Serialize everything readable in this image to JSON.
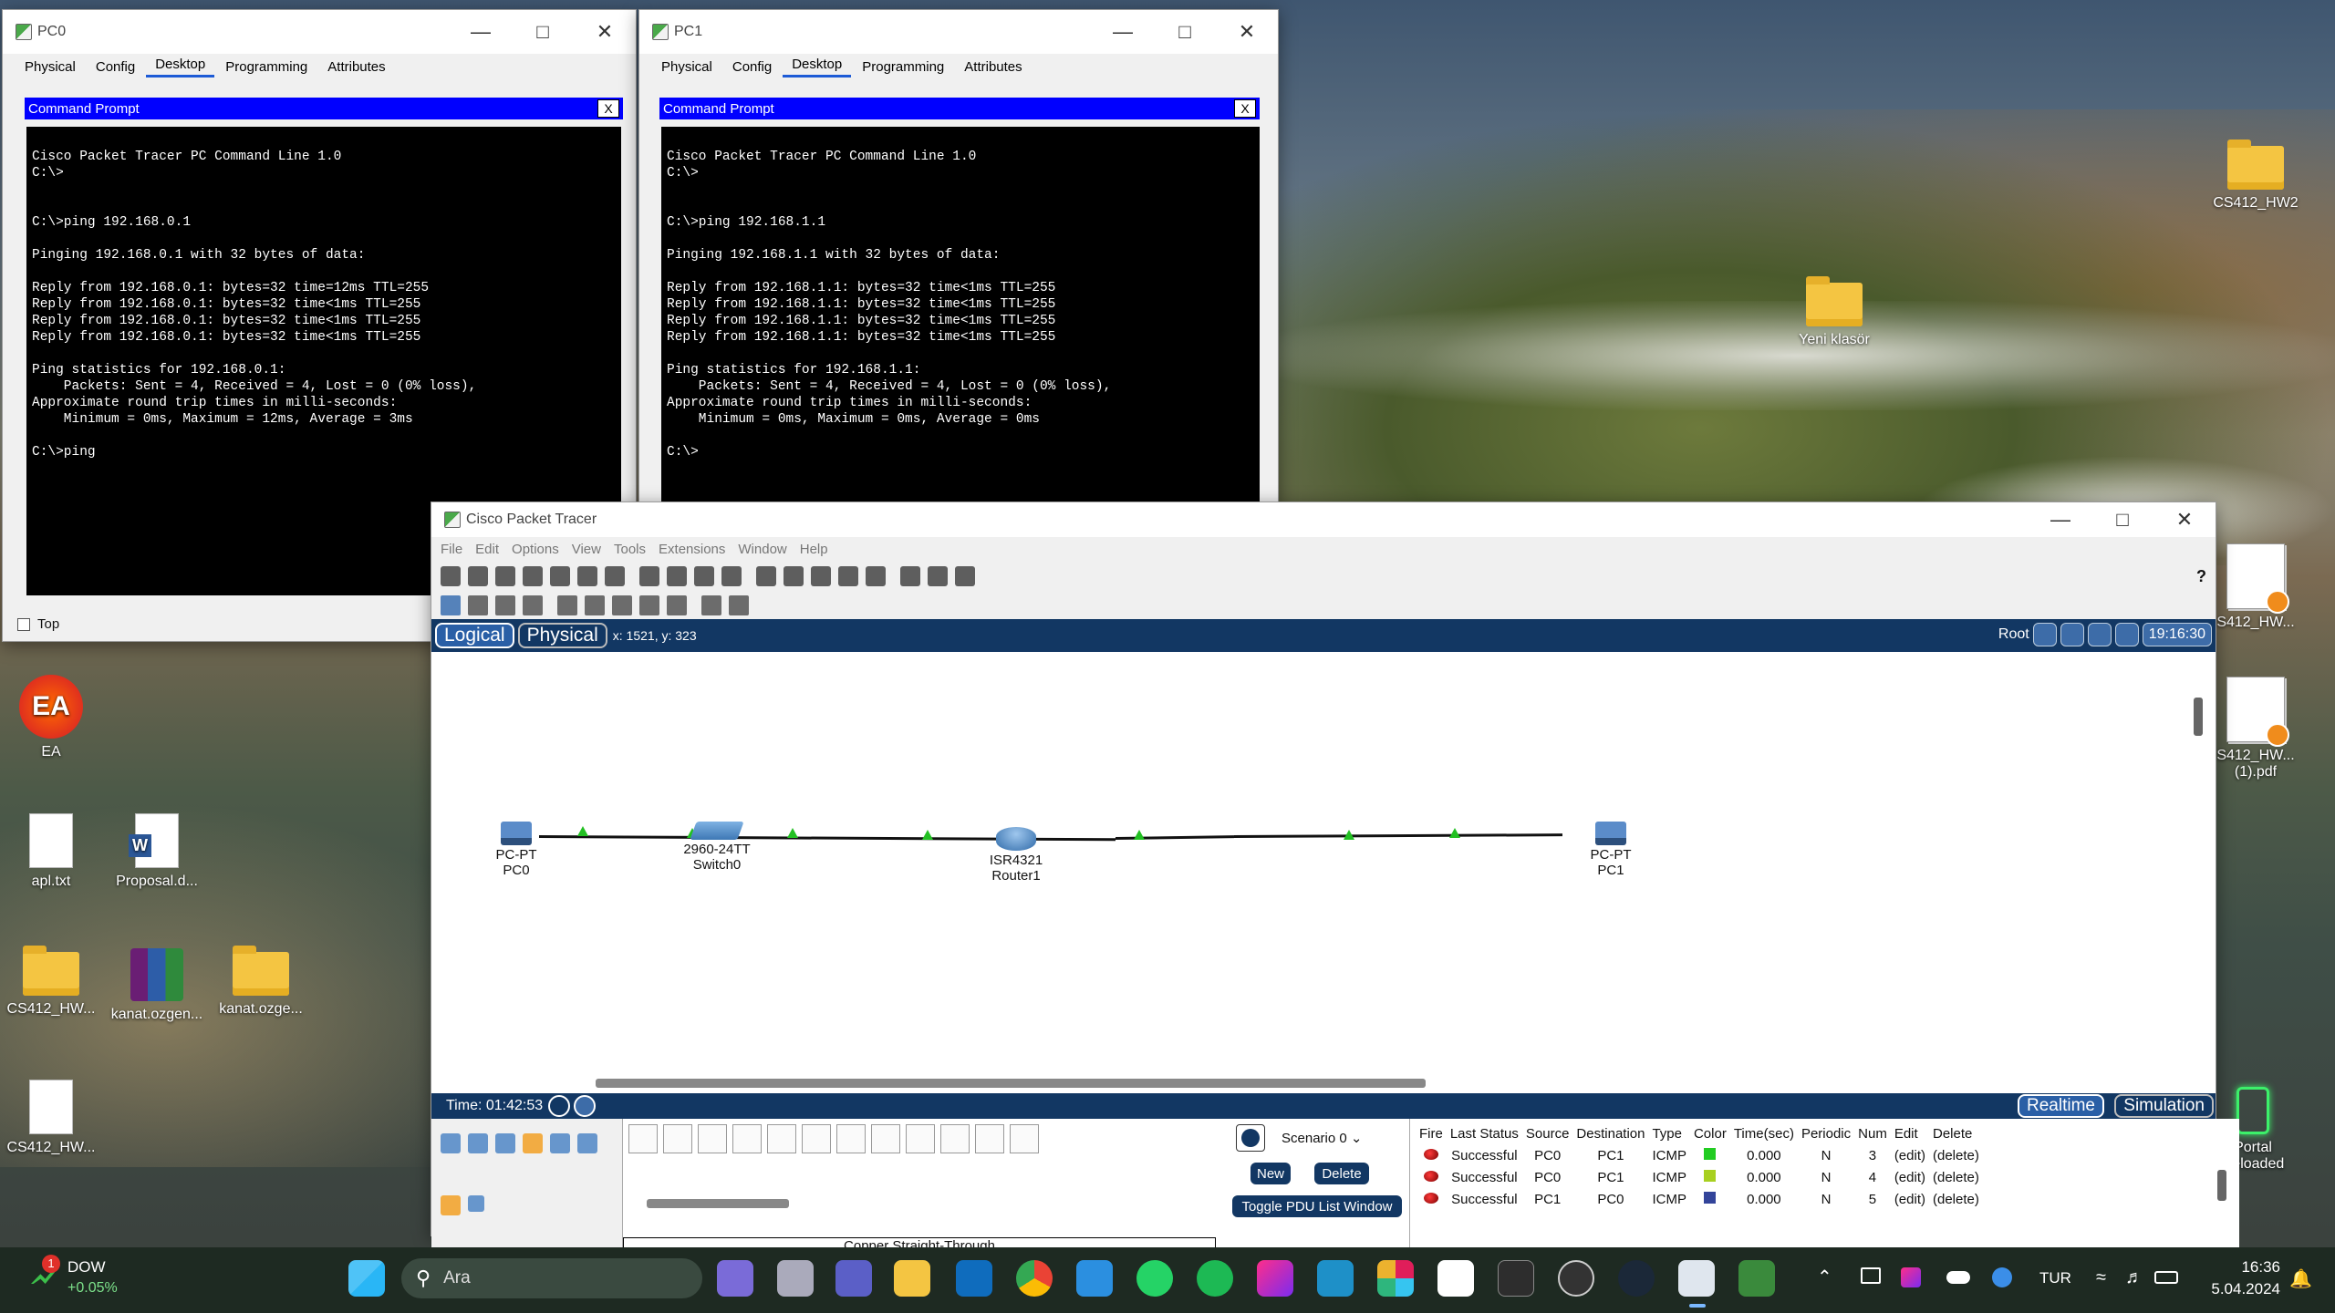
{
  "pc0": {
    "title": "PC0",
    "tabs": [
      "Physical",
      "Config",
      "Desktop",
      "Programming",
      "Attributes"
    ],
    "cmd_title": "Command Prompt",
    "cmd_close": "X",
    "top_label": "Top",
    "terminal": "\nCisco Packet Tracer PC Command Line 1.0\nC:\\>\n\n\nC:\\>ping 192.168.0.1\n\nPinging 192.168.0.1 with 32 bytes of data:\n\nReply from 192.168.0.1: bytes=32 time=12ms TTL=255\nReply from 192.168.0.1: bytes=32 time<1ms TTL=255\nReply from 192.168.0.1: bytes=32 time<1ms TTL=255\nReply from 192.168.0.1: bytes=32 time<1ms TTL=255\n\nPing statistics for 192.168.0.1:\n    Packets: Sent = 4, Received = 4, Lost = 0 (0% loss),\nApproximate round trip times in milli-seconds:\n    Minimum = 0ms, Maximum = 12ms, Average = 3ms\n\nC:\\>ping"
  },
  "pc1": {
    "title": "PC1",
    "tabs": [
      "Physical",
      "Config",
      "Desktop",
      "Programming",
      "Attributes"
    ],
    "cmd_title": "Command Prompt",
    "cmd_close": "X",
    "terminal": "\nCisco Packet Tracer PC Command Line 1.0\nC:\\>\n\n\nC:\\>ping 192.168.1.1\n\nPinging 192.168.1.1 with 32 bytes of data:\n\nReply from 192.168.1.1: bytes=32 time<1ms TTL=255\nReply from 192.168.1.1: bytes=32 time<1ms TTL=255\nReply from 192.168.1.1: bytes=32 time<1ms TTL=255\nReply from 192.168.1.1: bytes=32 time<1ms TTL=255\n\nPing statistics for 192.168.1.1:\n    Packets: Sent = 4, Received = 4, Lost = 0 (0% loss),\nApproximate round trip times in milli-seconds:\n    Minimum = 0ms, Maximum = 0ms, Average = 0ms\n\nC:\\>"
  },
  "pt": {
    "title": "Cisco Packet Tracer",
    "menu": [
      "File",
      "Edit",
      "Options",
      "View",
      "Tools",
      "Extensions",
      "Window",
      "Help"
    ],
    "help": "?",
    "logical": "Logical",
    "physical": "Physical",
    "coords": "x: 1521, y: 323",
    "root": "Root",
    "clock": "19:16:30",
    "devices": [
      {
        "line1": "PC-PT",
        "line2": "PC0"
      },
      {
        "line1": "2960-24TT",
        "line2": "Switch0"
      },
      {
        "line1": "ISR4321",
        "line2": "Router1"
      },
      {
        "line1": "PC-PT",
        "line2": "PC1"
      }
    ],
    "time_label": "Time: 01:42:53",
    "realtime": "Realtime",
    "simulation": "Simulation",
    "cable_label": "Copper Straight-Through",
    "scenario": "Scenario 0",
    "new_btn": "New",
    "delete_btn": "Delete",
    "toggle_btn": "Toggle PDU List Window",
    "pdu_headers": [
      "Fire",
      "Last Status",
      "Source",
      "Destination",
      "Type",
      "Color",
      "Time(sec)",
      "Periodic",
      "Num",
      "Edit",
      "Delete"
    ],
    "pdu_rows": [
      {
        "status": "Successful",
        "source": "PC0",
        "dest": "PC1",
        "type": "ICMP",
        "color": "#22cc22",
        "time": "0.000",
        "periodic": "N",
        "num": "3",
        "edit": "(edit)",
        "delete": "(delete)"
      },
      {
        "status": "Successful",
        "source": "PC0",
        "dest": "PC1",
        "type": "ICMP",
        "color": "#a8d020",
        "time": "0.000",
        "periodic": "N",
        "num": "4",
        "edit": "(edit)",
        "delete": "(delete)"
      },
      {
        "status": "Successful",
        "source": "PC1",
        "dest": "PC0",
        "type": "ICMP",
        "color": "#33449a",
        "time": "0.000",
        "periodic": "N",
        "num": "5",
        "edit": "(edit)",
        "delete": "(delete)"
      }
    ]
  },
  "desktop": {
    "cs412_hw2": "CS412_HW2",
    "yeni": "Yeni klasör",
    "pdf1": "S412_HW...",
    "pdf2a": "S412_HW...",
    "pdf2b": "(1).pdf",
    "ea": "EA",
    "apl": "apl.txt",
    "proposal": "Proposal.d...",
    "cs412_hw": "CS412_HW...",
    "kanat1": "kanat.ozgen...",
    "kanat2": "kanat.ozge...",
    "cs412_hw_txt": "CS412_HW...",
    "portal1": "Portal",
    "portal2": "Reloaded"
  },
  "taskbar": {
    "dow": "DOW",
    "dow_change": "+0.05%",
    "dow_badge": "1",
    "search": "Ara",
    "lang": "TUR",
    "time": "16:36",
    "date": "5.04.2024"
  }
}
